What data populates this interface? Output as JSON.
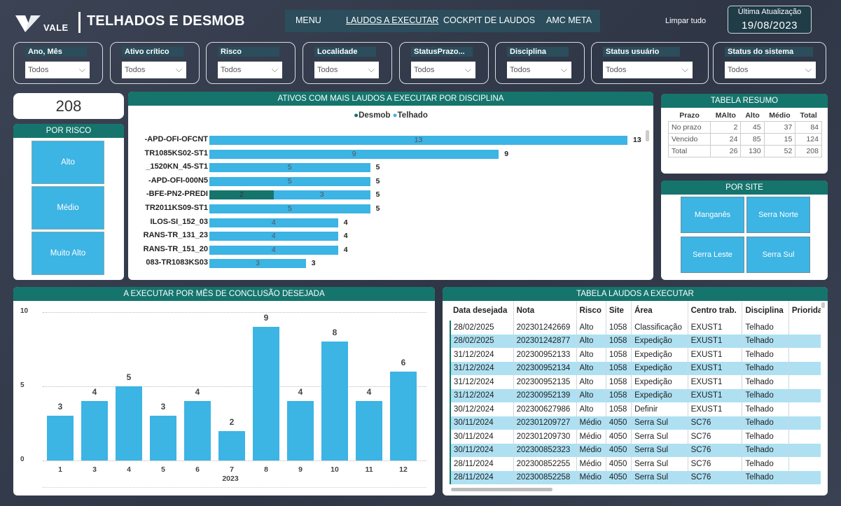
{
  "header": {
    "logo_text": "VALE",
    "title": "TELHADOS E DESMOB",
    "nav": [
      "MENU",
      "LAUDOS A EXECUTAR",
      "COCKPIT DE LAUDOS",
      "AMC META"
    ],
    "clear_all": "Limpar tudo",
    "update_label": "Última Atualização",
    "update_date": "19/08/2023"
  },
  "filters": [
    {
      "label": "Ano, Mês",
      "value": "Todos"
    },
    {
      "label": "Ativo crítico",
      "value": "Todos"
    },
    {
      "label": "Risco",
      "value": "Todos"
    },
    {
      "label": "Localidade",
      "value": "Todos"
    },
    {
      "label": "StatusPrazo...",
      "value": "Todos"
    },
    {
      "label": "Disciplina",
      "value": "Todos"
    },
    {
      "label": "Status usuário",
      "value": "Todos"
    },
    {
      "label": "Status do sistema",
      "value": "Todos"
    }
  ],
  "kpi": {
    "total": "208"
  },
  "risk_panel": {
    "title": "POR RISCO",
    "items": [
      "Alto",
      "Médio",
      "Muito Alto"
    ]
  },
  "assets_chart": {
    "title": "ATIVOS COM MAIS LAUDOS A EXECUTAR POR DISCIPLINA",
    "legend": [
      {
        "name": "Desmob",
        "color": "#15756d"
      },
      {
        "name": "Telhado",
        "color": "#3cb4e4"
      }
    ],
    "rows": [
      {
        "label": "-APD-OFI-OFCNT",
        "desmob": 0,
        "telhado": 13,
        "total": 13
      },
      {
        "label": "TR1085KS02-ST1",
        "desmob": 0,
        "telhado": 9,
        "total": 9
      },
      {
        "label": "_1520KN_45-ST1",
        "desmob": 0,
        "telhado": 5,
        "total": 5
      },
      {
        "label": "-APD-OFI-000N5",
        "desmob": 0,
        "telhado": 5,
        "total": 5
      },
      {
        "label": "-BFE-PN2-PREDI",
        "desmob": 2,
        "telhado": 3,
        "total": 5
      },
      {
        "label": "TR2011KS09-ST1",
        "desmob": 0,
        "telhado": 5,
        "total": 5
      },
      {
        "label": "ILOS-SI_152_03",
        "desmob": 0,
        "telhado": 4,
        "total": 4
      },
      {
        "label": "RANS-TR_131_23",
        "desmob": 0,
        "telhado": 4,
        "total": 4
      },
      {
        "label": "RANS-TR_151_20",
        "desmob": 0,
        "telhado": 4,
        "total": 4
      },
      {
        "label": "083-TR1083KS03",
        "desmob": 0,
        "telhado": 3,
        "total": 3
      }
    ]
  },
  "resumo": {
    "title": "TABELA RESUMO",
    "headers": [
      "Prazo",
      "MAlto",
      "Alto",
      "Médio",
      "Total"
    ],
    "rows": [
      [
        "No prazo",
        "2",
        "45",
        "37",
        "84"
      ],
      [
        "Vencido",
        "24",
        "85",
        "15",
        "124"
      ],
      [
        "Total",
        "26",
        "130",
        "52",
        "208"
      ]
    ]
  },
  "sites": {
    "title": "POR SITE",
    "items": [
      "Manganês",
      "Serra Norte",
      "Serra Leste",
      "Serra Sul"
    ]
  },
  "chart_data": {
    "type": "bar",
    "title": "A EXECUTAR POR MÊS DE CONCLUSÃO DESEJADA",
    "categories": [
      "1",
      "3",
      "4",
      "5",
      "6",
      "7",
      "8",
      "9",
      "10",
      "11",
      "12"
    ],
    "values": [
      3,
      4,
      5,
      3,
      4,
      2,
      9,
      4,
      8,
      4,
      6
    ],
    "xlabel": "2023",
    "ylabel": "",
    "ylim": [
      0,
      10
    ],
    "yticks": [
      0,
      5,
      10
    ],
    "color": "#3cb4e4",
    "grid": true
  },
  "laudos": {
    "title": "TABELA LAUDOS A EXECUTAR",
    "headers": [
      "Data desejada",
      "Nota",
      "Risco",
      "Site",
      "Área",
      "Centro trab.",
      "Disciplina",
      "Priorida"
    ],
    "rows": [
      [
        "28/02/2025",
        "202301242669",
        "Alto",
        "1058",
        "Classificação",
        "EXUST1",
        "Telhado",
        ""
      ],
      [
        "28/02/2025",
        "202301242877",
        "Alto",
        "1058",
        "Expedição",
        "EXUST1",
        "Telhado",
        ""
      ],
      [
        "31/12/2024",
        "202300952133",
        "Alto",
        "1058",
        "Expedição",
        "EXUST1",
        "Telhado",
        ""
      ],
      [
        "31/12/2024",
        "202300952134",
        "Alto",
        "1058",
        "Expedição",
        "EXUST1",
        "Telhado",
        ""
      ],
      [
        "31/12/2024",
        "202300952135",
        "Alto",
        "1058",
        "Expedição",
        "EXUST1",
        "Telhado",
        ""
      ],
      [
        "31/12/2024",
        "202300952139",
        "Alto",
        "1058",
        "Expedição",
        "EXUST1",
        "Telhado",
        ""
      ],
      [
        "30/12/2024",
        "202300627986",
        "Alto",
        "1058",
        "Definir",
        "EXUST1",
        "Telhado",
        ""
      ],
      [
        "30/11/2024",
        "202301209727",
        "Médio",
        "4050",
        "Serra Sul",
        "SC76",
        "Telhado",
        ""
      ],
      [
        "30/11/2024",
        "202301209730",
        "Médio",
        "4050",
        "Serra Sul",
        "SC76",
        "Telhado",
        ""
      ],
      [
        "30/11/2024",
        "202300852323",
        "Médio",
        "4050",
        "Serra Sul",
        "SC76",
        "Telhado",
        ""
      ],
      [
        "28/11/2024",
        "202300852255",
        "Médio",
        "4050",
        "Serra Sul",
        "SC76",
        "Telhado",
        ""
      ],
      [
        "28/11/2024",
        "202300852258",
        "Médio",
        "4050",
        "Serra Sul",
        "SC76",
        "Telhado",
        ""
      ]
    ]
  }
}
